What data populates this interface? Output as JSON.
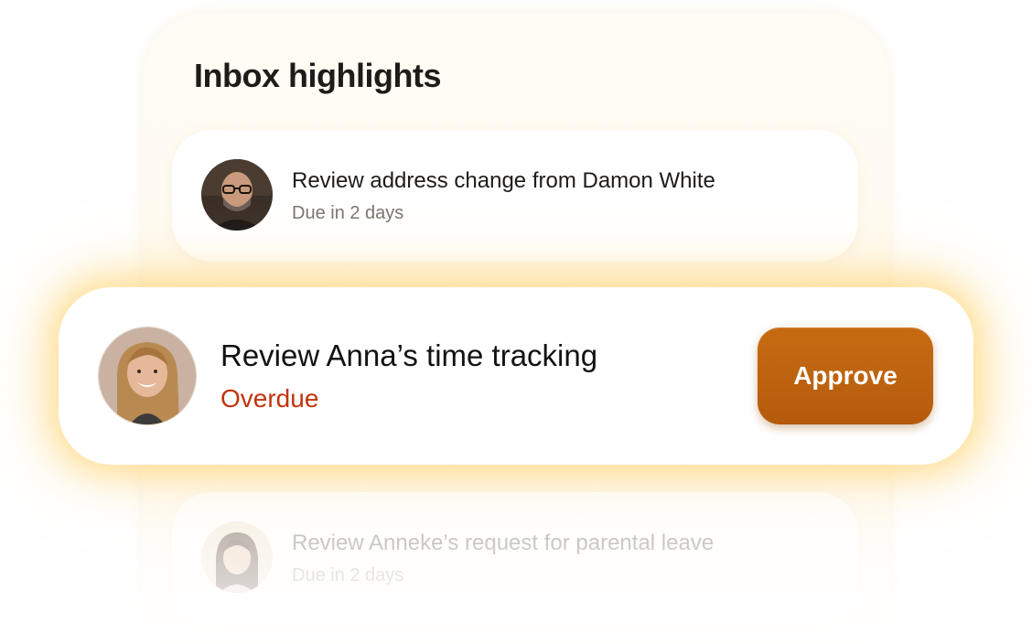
{
  "panel": {
    "title": "Inbox highlights"
  },
  "items": [
    {
      "title": "Review address change from Damon White",
      "subtitle": "Due in 2 days",
      "avatar_icon": "avatar-damon-icon"
    },
    {
      "title": "Review Anna’s time tracking",
      "status": "Overdue",
      "action_label": "Approve",
      "avatar_icon": "avatar-anna-icon"
    },
    {
      "title": "Review Anneke’s request for parental leave",
      "subtitle": "Due in 2 days",
      "avatar_icon": "avatar-anneke-icon"
    }
  ],
  "colors": {
    "accent": "#b9600e",
    "overdue": "#c2330e",
    "glow": "#ffd05c",
    "panel_bg": "#fffaf0",
    "text_primary": "#1e1b18",
    "text_secondary": "#7a746e"
  }
}
